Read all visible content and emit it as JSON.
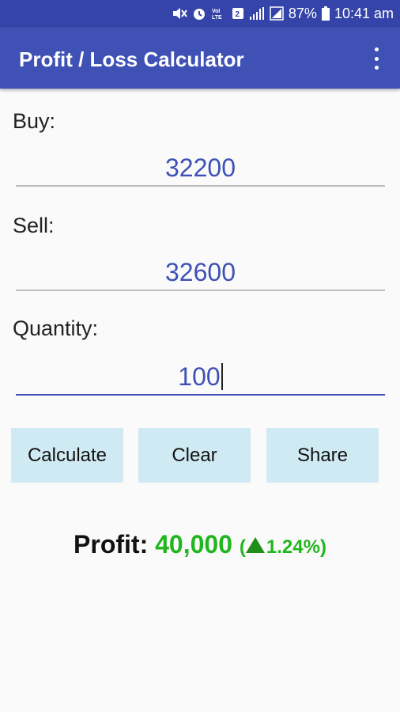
{
  "status_bar": {
    "battery_percent": "87%",
    "time": "10:41 am",
    "icons": [
      "mute-icon",
      "alarm-icon",
      "volte-icon",
      "sim2-icon",
      "signal-icon",
      "battery-icon"
    ]
  },
  "app_bar": {
    "title": "Profit / Loss Calculator",
    "menu_icon": "overflow-menu-icon"
  },
  "form": {
    "buy_label": "Buy:",
    "buy_value": "32200",
    "sell_label": "Sell:",
    "sell_value": "32600",
    "quantity_label": "Quantity:",
    "quantity_value": "100"
  },
  "buttons": {
    "calculate": "Calculate",
    "clear": "Clear",
    "share": "Share"
  },
  "result": {
    "label": "Profit:",
    "amount": "40,000",
    "open_paren": "(",
    "percent": "1.24%",
    "close_paren": ")"
  },
  "colors": {
    "primary": "#3f51b5",
    "primary_dark": "#3444a8",
    "button_bg": "#cfeaf3",
    "profit": "#22b61e"
  }
}
